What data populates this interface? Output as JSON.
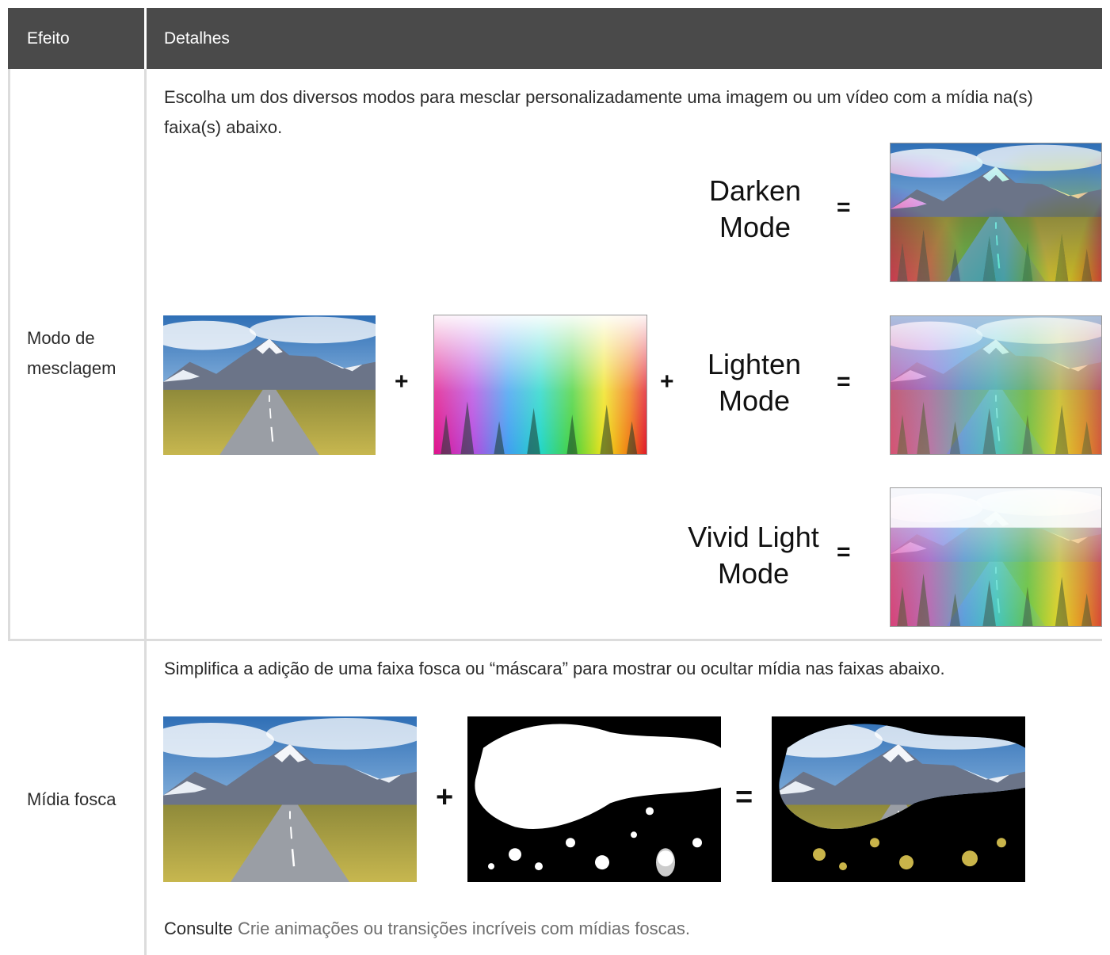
{
  "table": {
    "headers": {
      "effect": "Efeito",
      "details": "Detalhes"
    },
    "rows": [
      {
        "effect_lines": [
          "Modo de",
          "mesclagem"
        ],
        "description": "Escolha um dos diversos modos para mesclar personalizadamente uma imagem ou um vídeo com a mídia na(s) faixa(s) abaixo.",
        "diagram": {
          "plus": "+",
          "equals": "=",
          "modes": [
            {
              "line1": "Darken",
              "line2": "Mode"
            },
            {
              "line1": "Lighten",
              "line2": "Mode"
            },
            {
              "line1": "Vivid Light",
              "line2": "Mode"
            }
          ]
        }
      },
      {
        "effect_lines": [
          "Mídia fosca"
        ],
        "description": "Simplifica a adição de uma faixa fosca ou “máscara” para mostrar ou ocultar mídia nas faixas abaixo.",
        "diagram": {
          "plus": "+",
          "equals": "="
        },
        "consult_lead": "Consulte",
        "consult_link": "Crie animações ou transições incríveis com mídias foscas."
      }
    ]
  }
}
